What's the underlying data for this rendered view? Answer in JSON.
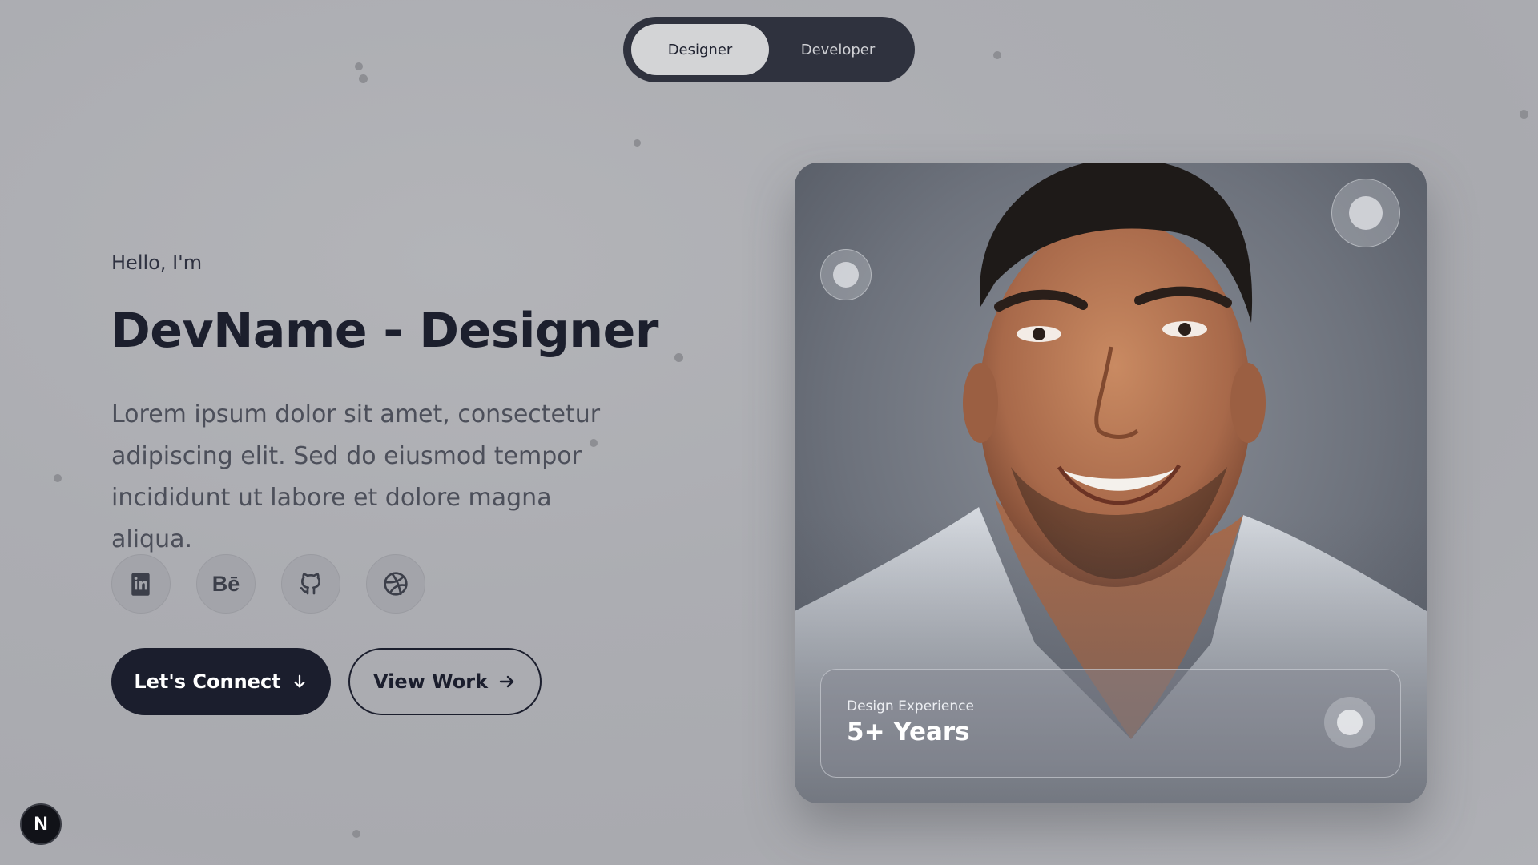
{
  "toggle": {
    "options": [
      "Designer",
      "Developer"
    ],
    "active": "Designer"
  },
  "hero": {
    "greeting": "Hello, I'm",
    "title": "DevName - Designer",
    "description": "Lorem ipsum dolor sit amet, consectetur adipiscing elit. Sed do eiusmod tempor incididunt ut labore et dolore magna aliqua."
  },
  "socials": [
    {
      "icon": "linkedin-icon"
    },
    {
      "icon": "behance-icon",
      "glyph": "Bē"
    },
    {
      "icon": "github-icon"
    },
    {
      "icon": "dribbble-icon"
    }
  ],
  "buttons": {
    "primary_label": "Let's Connect",
    "primary_icon": "arrow-down-icon",
    "secondary_label": "View Work",
    "secondary_icon": "arrow-right-icon"
  },
  "card": {
    "stat_label": "Design Experience",
    "stat_value": "5+ Years"
  },
  "badge": {
    "glyph": "N"
  },
  "colors": {
    "dark": "#1b1e2d",
    "toggle_bg": "#2f323e",
    "background": "#acadb2"
  }
}
